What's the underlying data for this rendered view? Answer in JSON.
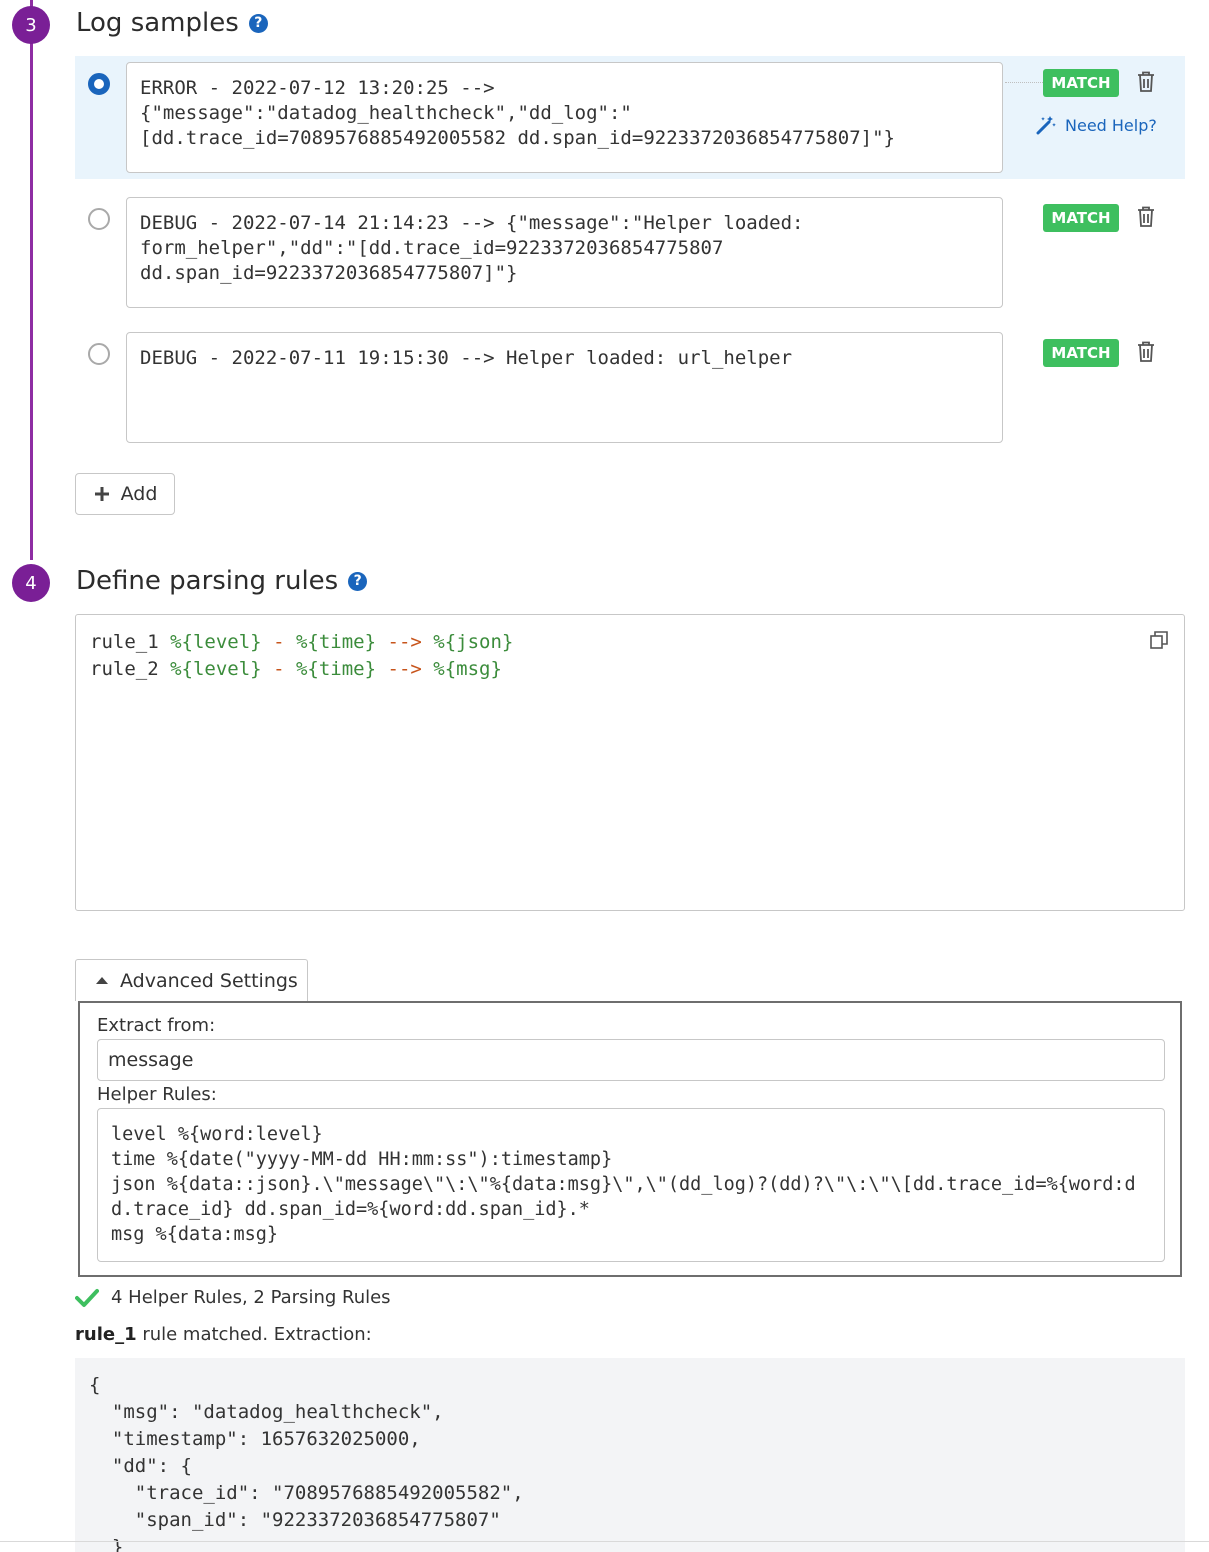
{
  "steps": [
    {
      "number": "3",
      "title": "Log samples"
    },
    {
      "number": "4",
      "title": "Define parsing rules"
    }
  ],
  "help_glyph": "?",
  "samples": [
    {
      "text": "ERROR - 2022-07-12 13:20:25 -->\n{\"message\":\"datadog_healthcheck\",\"dd_log\":\"\n[dd.trace_id=7089576885492005582 dd.span_id=9223372036854775807]\"}",
      "status": "MATCH",
      "selected": true
    },
    {
      "text": "DEBUG - 2022-07-14 21:14:23 --> {\"message\":\"Helper loaded:\nform_helper\",\"dd\":\"[dd.trace_id=9223372036854775807\ndd.span_id=9223372036854775807]\"}",
      "status": "MATCH",
      "selected": false
    },
    {
      "text": "DEBUG - 2022-07-11 19:15:30 --> Helper loaded: url_helper",
      "status": "MATCH",
      "selected": false
    }
  ],
  "need_help_label": "Need Help?",
  "add_label": "Add",
  "parsing_rules": [
    {
      "name": "rule_1",
      "level": "%{level}",
      "dash": "-",
      "time": "%{time}",
      "arrow": "-->",
      "capture": "%{json}"
    },
    {
      "name": "rule_2",
      "level": "%{level}",
      "dash": "-",
      "time": "%{time}",
      "arrow": "-->",
      "capture": "%{msg}"
    }
  ],
  "advanced": {
    "tab_label": "Advanced Settings",
    "extract_label": "Extract from:",
    "extract_value": "message",
    "helper_label": "Helper Rules:",
    "helper_rules": "level %{word:level}\ntime %{date(\"yyyy-MM-dd HH:mm:ss\"):timestamp}\njson %{data::json}.\\\"message\\\"\\:\\\"%{data:msg}\\\",\\\"(dd_log)?(dd)?\\\"\\:\\\"\\[dd.trace_id=%{word:dd.trace_id} dd.span_id=%{word:dd.span_id}.*\nmsg %{data:msg}"
  },
  "status": {
    "summary": "4 Helper Rules, 2 Parsing Rules",
    "matched_rule": "rule_1",
    "matched_text": " rule matched. Extraction:"
  },
  "extraction": "{\n  \"msg\": \"datadog_healthcheck\",\n  \"timestamp\": 1657632025000,\n  \"dd\": {\n    \"trace_id\": \"7089576885492005582\",\n    \"span_id\": \"9223372036854775807\"\n  }\n}",
  "colors": {
    "step": "#7a1f96",
    "accent": "#1a65bc",
    "match": "#3ebf5f",
    "selected_row": "#e9f4fc",
    "token_green": "#3b8c3b",
    "token_orange": "#c7541b"
  },
  "icons": [
    "help-icon",
    "trash-icon",
    "magic-wand-icon",
    "plus-icon",
    "copy-icon",
    "caret-up-icon",
    "check-icon"
  ]
}
